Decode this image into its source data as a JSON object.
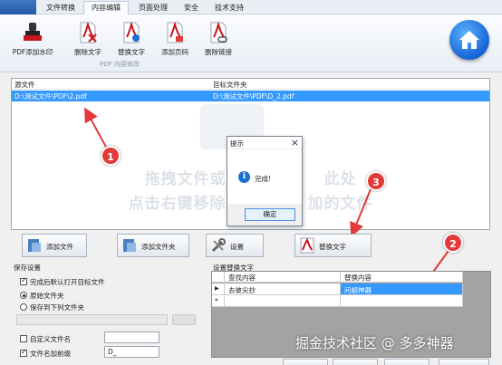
{
  "tabs": [
    {
      "label": "文件转换",
      "active": false
    },
    {
      "label": "内容编辑",
      "active": true
    },
    {
      "label": "页面处理",
      "active": false
    },
    {
      "label": "安全",
      "active": false
    },
    {
      "label": "技术支持",
      "active": false
    }
  ],
  "ribbon": {
    "buttons": [
      {
        "label": "PDF添加水印",
        "icon": "stamp-icon"
      },
      {
        "label": "删除文字",
        "icon": "pdf-delete-text-icon"
      },
      {
        "label": "替换文字",
        "icon": "pdf-replace-text-icon"
      },
      {
        "label": "添加页码",
        "icon": "pdf-add-page-number-icon"
      },
      {
        "label": "删除链接",
        "icon": "pdf-delete-link-icon"
      }
    ],
    "group_label": "PDF 内容修改",
    "home_icon": "home-icon"
  },
  "file_list": {
    "col_source": "源文件",
    "col_target": "目标文件夹",
    "rows": [
      {
        "source": "D:\\测试文件\\PDF\\2.pdf",
        "target": "D:\\测试文件\\PDF\\D_2.pdf"
      }
    ],
    "hint_line1": "拖拽文件或　　　　　　此处",
    "hint_line2": "点击右键移除或　　　　加的文件"
  },
  "dialog": {
    "title": "提示",
    "close": "×",
    "message": "完成!",
    "ok_label": "确定"
  },
  "markers": [
    "1",
    "2",
    "3"
  ],
  "actions": {
    "add_file": "添加文件",
    "add_folder": "添加文件夹",
    "settings": "设置",
    "replace_text": "替换文字"
  },
  "save_settings": {
    "title": "保存设置",
    "open_after": "完成后默认打开目标文件",
    "original_folder": "原始文件夹",
    "save_to": "保存到下列文件夹",
    "custom_name": "自定义文件名",
    "prefix_label": "文件名加前缀",
    "prefix_value": "D_"
  },
  "replace_settings": {
    "title": "设置替换文字",
    "col_find": "查找内容",
    "col_replace": "替换内容",
    "rows": [
      {
        "find": "去彼尖抄",
        "replace": "问超神器"
      }
    ],
    "new_row_marker": "*",
    "current_row_marker": "▶"
  },
  "watermark": "掘金技术社区 @ 多多神器",
  "colors": {
    "selection": "#3399ff",
    "marker_red": "#e23a3a",
    "home_blue": "#1664d6"
  }
}
